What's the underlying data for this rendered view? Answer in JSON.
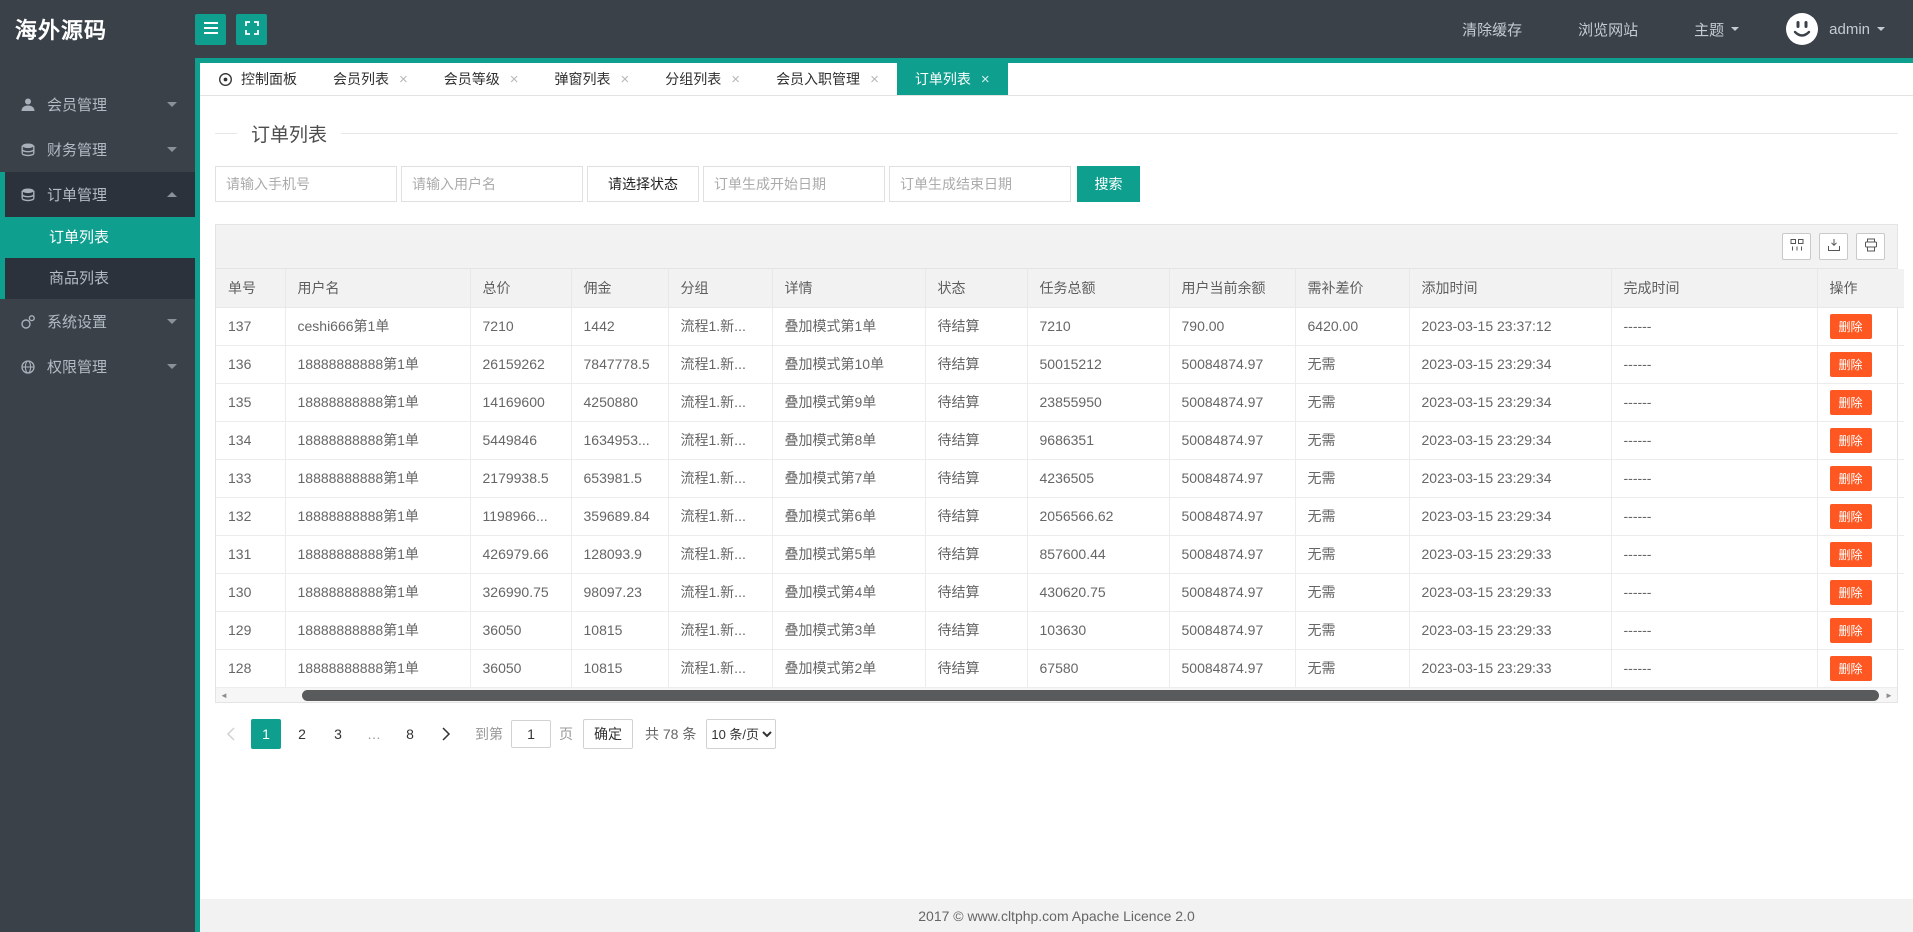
{
  "brand": "海外源码",
  "topbar": {
    "clear_cache": "清除缓存",
    "browse_site": "浏览网站",
    "theme": "主题",
    "username": "admin"
  },
  "sidebar": {
    "items": [
      {
        "label": "会员管理",
        "icon": "user-icon",
        "expanded": false
      },
      {
        "label": "财务管理",
        "icon": "finance-icon",
        "expanded": false
      },
      {
        "label": "订单管理",
        "icon": "orders-icon",
        "expanded": true,
        "children": [
          {
            "label": "订单列表",
            "active": true
          },
          {
            "label": "商品列表",
            "active": false
          }
        ]
      },
      {
        "label": "系统设置",
        "icon": "settings-icon",
        "expanded": false
      },
      {
        "label": "权限管理",
        "icon": "permissions-icon",
        "expanded": false
      }
    ]
  },
  "tabs": [
    {
      "label": "控制面板",
      "closable": false,
      "active": false
    },
    {
      "label": "会员列表",
      "closable": true,
      "active": false
    },
    {
      "label": "会员等级",
      "closable": true,
      "active": false
    },
    {
      "label": "弹窗列表",
      "closable": true,
      "active": false
    },
    {
      "label": "分组列表",
      "closable": true,
      "active": false
    },
    {
      "label": "会员入职管理",
      "closable": true,
      "active": false
    },
    {
      "label": "订单列表",
      "closable": true,
      "active": true
    }
  ],
  "page": {
    "title": "订单列表"
  },
  "filters": {
    "phone_placeholder": "请输入手机号",
    "username_placeholder": "请输入用户名",
    "status_button": "请选择状态",
    "start_date_placeholder": "订单生成开始日期",
    "end_date_placeholder": "订单生成结束日期",
    "search_button": "搜索"
  },
  "table": {
    "columns": [
      "单号",
      "用户名",
      "总价",
      "佣金",
      "分组",
      "详情",
      "状态",
      "任务总额",
      "用户当前余额",
      "需补差价",
      "添加时间",
      "完成时间",
      "操作"
    ],
    "delete_label": "删除",
    "rows": [
      [
        "137",
        "ceshi666第1单",
        "7210",
        "1442",
        "流程1.新...",
        "叠加模式第1单",
        "待结算",
        "7210",
        "790.00",
        "6420.00",
        "2023-03-15 23:37:12",
        "------"
      ],
      [
        "136",
        "18888888888第1单",
        "26159262",
        "7847778.5",
        "流程1.新...",
        "叠加模式第10单",
        "待结算",
        "50015212",
        "50084874.97",
        "无需",
        "2023-03-15 23:29:34",
        "------"
      ],
      [
        "135",
        "18888888888第1单",
        "14169600",
        "4250880",
        "流程1.新...",
        "叠加模式第9单",
        "待结算",
        "23855950",
        "50084874.97",
        "无需",
        "2023-03-15 23:29:34",
        "------"
      ],
      [
        "134",
        "18888888888第1单",
        "5449846",
        "1634953...",
        "流程1.新...",
        "叠加模式第8单",
        "待结算",
        "9686351",
        "50084874.97",
        "无需",
        "2023-03-15 23:29:34",
        "------"
      ],
      [
        "133",
        "18888888888第1单",
        "2179938.5",
        "653981.5",
        "流程1.新...",
        "叠加模式第7单",
        "待结算",
        "4236505",
        "50084874.97",
        "无需",
        "2023-03-15 23:29:34",
        "------"
      ],
      [
        "132",
        "18888888888第1单",
        "1198966...",
        "359689.84",
        "流程1.新...",
        "叠加模式第6单",
        "待结算",
        "2056566.62",
        "50084874.97",
        "无需",
        "2023-03-15 23:29:34",
        "------"
      ],
      [
        "131",
        "18888888888第1单",
        "426979.66",
        "128093.9",
        "流程1.新...",
        "叠加模式第5单",
        "待结算",
        "857600.44",
        "50084874.97",
        "无需",
        "2023-03-15 23:29:33",
        "------"
      ],
      [
        "130",
        "18888888888第1单",
        "326990.75",
        "98097.23",
        "流程1.新...",
        "叠加模式第4单",
        "待结算",
        "430620.75",
        "50084874.97",
        "无需",
        "2023-03-15 23:29:33",
        "------"
      ],
      [
        "129",
        "18888888888第1单",
        "36050",
        "10815",
        "流程1.新...",
        "叠加模式第3单",
        "待结算",
        "103630",
        "50084874.97",
        "无需",
        "2023-03-15 23:29:33",
        "------"
      ],
      [
        "128",
        "18888888888第1单",
        "36050",
        "10815",
        "流程1.新...",
        "叠加模式第2单",
        "待结算",
        "67580",
        "50084874.97",
        "无需",
        "2023-03-15 23:29:33",
        "------"
      ]
    ]
  },
  "pagination": {
    "pages": [
      "1",
      "2",
      "3",
      "…",
      "8"
    ],
    "active_page": "1",
    "goto_label": "到第",
    "goto_value": "1",
    "page_unit": "页",
    "confirm_label": "确定",
    "total_label": "共 78 条",
    "per_page": "10 条/页"
  },
  "footer": {
    "text": "2017 ©  www.cltphp.com  Apache Licence 2.0"
  },
  "colors": {
    "primary": "#0f9f8f",
    "danger": "#ff5722",
    "dark": "#3a4149"
  }
}
